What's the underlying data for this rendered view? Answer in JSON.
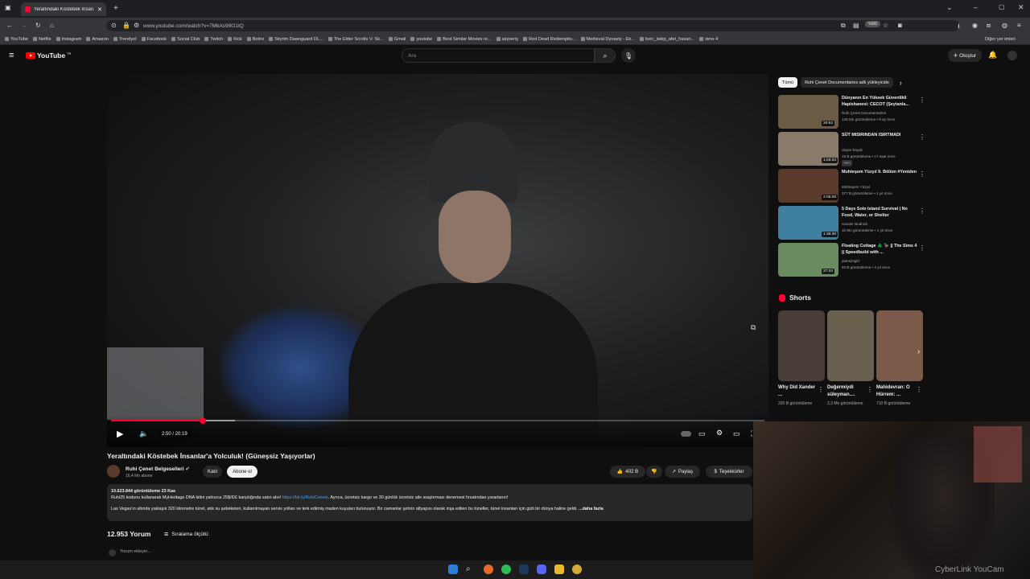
{
  "browser": {
    "tab_title": "Yeraltındaki Köstebek İnsan...",
    "url": "www.youtube.com/watch?v=7MkAs99O1tQ",
    "zoom": "%80",
    "bookmarks": [
      "YouTube",
      "Netflix",
      "Instagram",
      "Amazon",
      "Trendyol",
      "Facebook",
      "Social Club",
      "Twitch",
      "Kick",
      "Botrix",
      "Skyrim Dawnguard DL...",
      "The Elder Scrolls V: Sk...",
      "Gmail",
      "youtube",
      "Best Similar Movies re...",
      "alışveriş",
      "Red Dead Redemptio...",
      "Medieval Dynasty - Ek...",
      "borc_takip_afet_hasan...",
      "sims 4"
    ],
    "other_bookmarks": "Diğer yer imleri"
  },
  "youtube": {
    "logo": "YouTube",
    "logo_region": "TR",
    "search_placeholder": "Ara",
    "create_label": "Oluştur"
  },
  "player": {
    "time": "2:50 / 20:19",
    "progress_fraction": 0.14,
    "buffered_fraction": 0.19
  },
  "video": {
    "title": "Yeraltındaki Köstebek İnsanlar'a Yolculuk! (Güneşsiz Yaşıyorlar)",
    "channel": "Ruhi Çenet Belgeselleri",
    "subscribers": "16,4 Mn abone",
    "join_label": "Katıl",
    "subscribe_label": "Abone ol",
    "likes": "402 B",
    "share_label": "Paylaş",
    "thanks_label": "Teşekkürler",
    "desc_stats": "10.623.844 görüntüleme  23 Kas",
    "desc_line1_pre": "Ruhi25 kodunu kullanarak MyHeritage DNA kitini yalnızca 25$/€/£ karşılığında satın alın! ",
    "desc_link": "https://bit.ly/RuhiCenetz",
    "desc_line1_post": ". Ayrıca, ücretsiz kargo ve 30 günlük ücretsiz aile araştırması denemesi fırsatından yararlanın!",
    "desc_line2": "Las Vegas'ın altında yaklaşık 320 kilometre tünel, atık su şebekeleri, kullanılmayan servis yolları ve terk edilmiş maden kuyuları bulunuyor. Bir zamanlar şehrin altyapısı olarak inşa edilen bu tüneller, tünel insanları için gizli bir dünya haline geldi.",
    "desc_more": "...daha fazla",
    "comment_count": "12.953 Yorum",
    "sort_label": "Sıralama ölçütü:",
    "add_comment": "Yorum ekleyin..."
  },
  "sidebar": {
    "chips": [
      "Tümü",
      "Ruhi Çenet Documentaries adlı yükleyicide"
    ],
    "recs": [
      {
        "title": "Dünyanın En Yüksek Güvenlikli Hapishanesi: CECOT (Şeytanla...",
        "channel": "Ruhi Çenet Documentaries",
        "meta": "148 Mn görüntüleme • 9 ay önce",
        "duration": "20:52",
        "color": "#6b5a44"
      },
      {
        "title": "SÜT MISIRINDAN ISIRTMADI",
        "channel": "okşan böyük",
        "meta": "18 B görüntüleme • 17 saat önce",
        "badge": "Yeni",
        "duration": "1:03:34",
        "color": "#8a7a6a"
      },
      {
        "title": "Muhteşem Yüzyıl 9. Bölüm #Yeniden",
        "channel": "Muhteşem Yüzyıl",
        "meta": "377 B görüntüleme • 1 yıl önce",
        "duration": "2:05:08",
        "color": "#5a3a2a"
      },
      {
        "title": "5 Days Solo Island Survival | No Food, Water, or Shelter",
        "channel": "Xander Budnick",
        "meta": "10 Mn görüntüleme • 1 yıl önce",
        "duration": "1:36:30",
        "color": "#3f7fa0"
      },
      {
        "title": "Floating Cottage 🌲 🦆 || The Sims 4 || Speedbuild with ...",
        "channel": "plansimgirl",
        "meta": "50 B görüntüleme • 4 yıl önce",
        "duration": "27:33",
        "color": "#6a8a60"
      }
    ],
    "shorts_label": "Shorts",
    "shorts": [
      {
        "title": "Why Did Xander ...",
        "views": "220 B görüntüleme",
        "color": "#4a3e38"
      },
      {
        "title": "Değermiydi süleyman....",
        "views": "2,3 Mn görüntüleme",
        "color": "#6a6050"
      },
      {
        "title": "Mahidevran: O Hürrem: ...",
        "views": "710 B görüntüleme",
        "color": "#7a5a4a"
      }
    ]
  },
  "overlay": {
    "watermark": "CyberLink YouCam"
  }
}
